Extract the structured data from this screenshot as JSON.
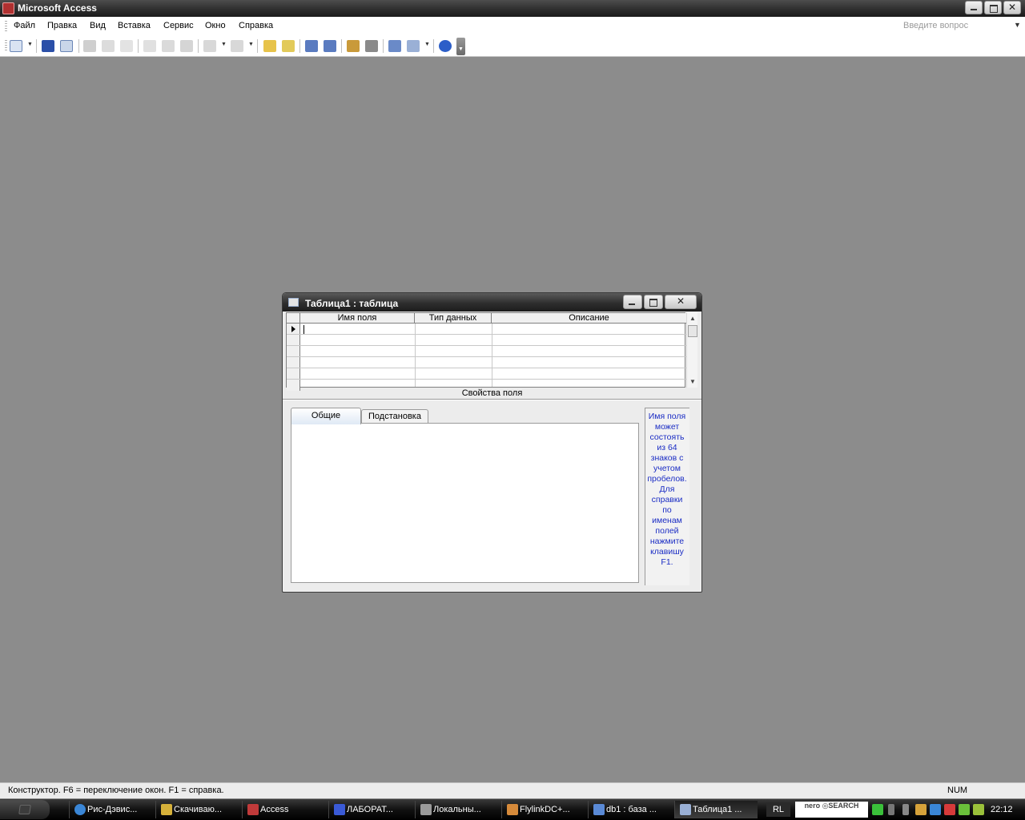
{
  "app": {
    "title": "Microsoft Access",
    "window_controls": {
      "close": "✕"
    }
  },
  "menubar": {
    "items": [
      "Файл",
      "Правка",
      "Вид",
      "Вставка",
      "Сервис",
      "Окно",
      "Справка"
    ],
    "question_placeholder": "Введите вопрос"
  },
  "toolbar": {
    "icons": [
      "view-icon",
      "save-icon",
      "search-icon",
      "print-icon",
      "print-preview-icon",
      "spelling-icon",
      "cut-icon",
      "copy-icon",
      "paste-icon",
      "undo-icon",
      "redo-icon",
      "primary-key-icon",
      "build-icon",
      "insert-rows-icon",
      "delete-rows-icon",
      "properties-icon",
      "build-wizard-icon",
      "database-window-icon",
      "new-object-icon",
      "help-icon"
    ]
  },
  "table_window": {
    "title": "Таблица1 : таблица",
    "columns": [
      "Имя поля",
      "Тип данных",
      "Описание"
    ],
    "row_count": 6,
    "props_label": "Свойства поля",
    "tabs": [
      "Общие",
      "Подстановка"
    ],
    "help_text": "Имя поля может состоять из 64 знаков с учетом пробелов. Для справки по именам полей нажмите клавишу F1."
  },
  "statusbar": {
    "text": "Конструктор.  F6 = переключение окон.  F1 = справка.",
    "num": "NUM"
  },
  "taskbar": {
    "tasks": [
      {
        "label": "Рис-Дэвис...",
        "color": "#3a86d6"
      },
      {
        "label": "Скачиваю...",
        "color": "#d6b13a"
      },
      {
        "label": "Access",
        "color": "#c03a3a"
      },
      {
        "label": "ЛАБОРАТ...",
        "color": "#3a5ad6"
      },
      {
        "label": "Локальны...",
        "color": "#9a9a9a"
      },
      {
        "label": "FlylinkDC+...",
        "color": "#d68a3a"
      },
      {
        "label": "db1 : база ...",
        "color": "#5a8ad6"
      },
      {
        "label": "Таблица1 ...",
        "color": "#9ab0d6"
      }
    ],
    "lang": "RL",
    "nero": "nero ◎SEARCH",
    "clock": "22:12"
  }
}
